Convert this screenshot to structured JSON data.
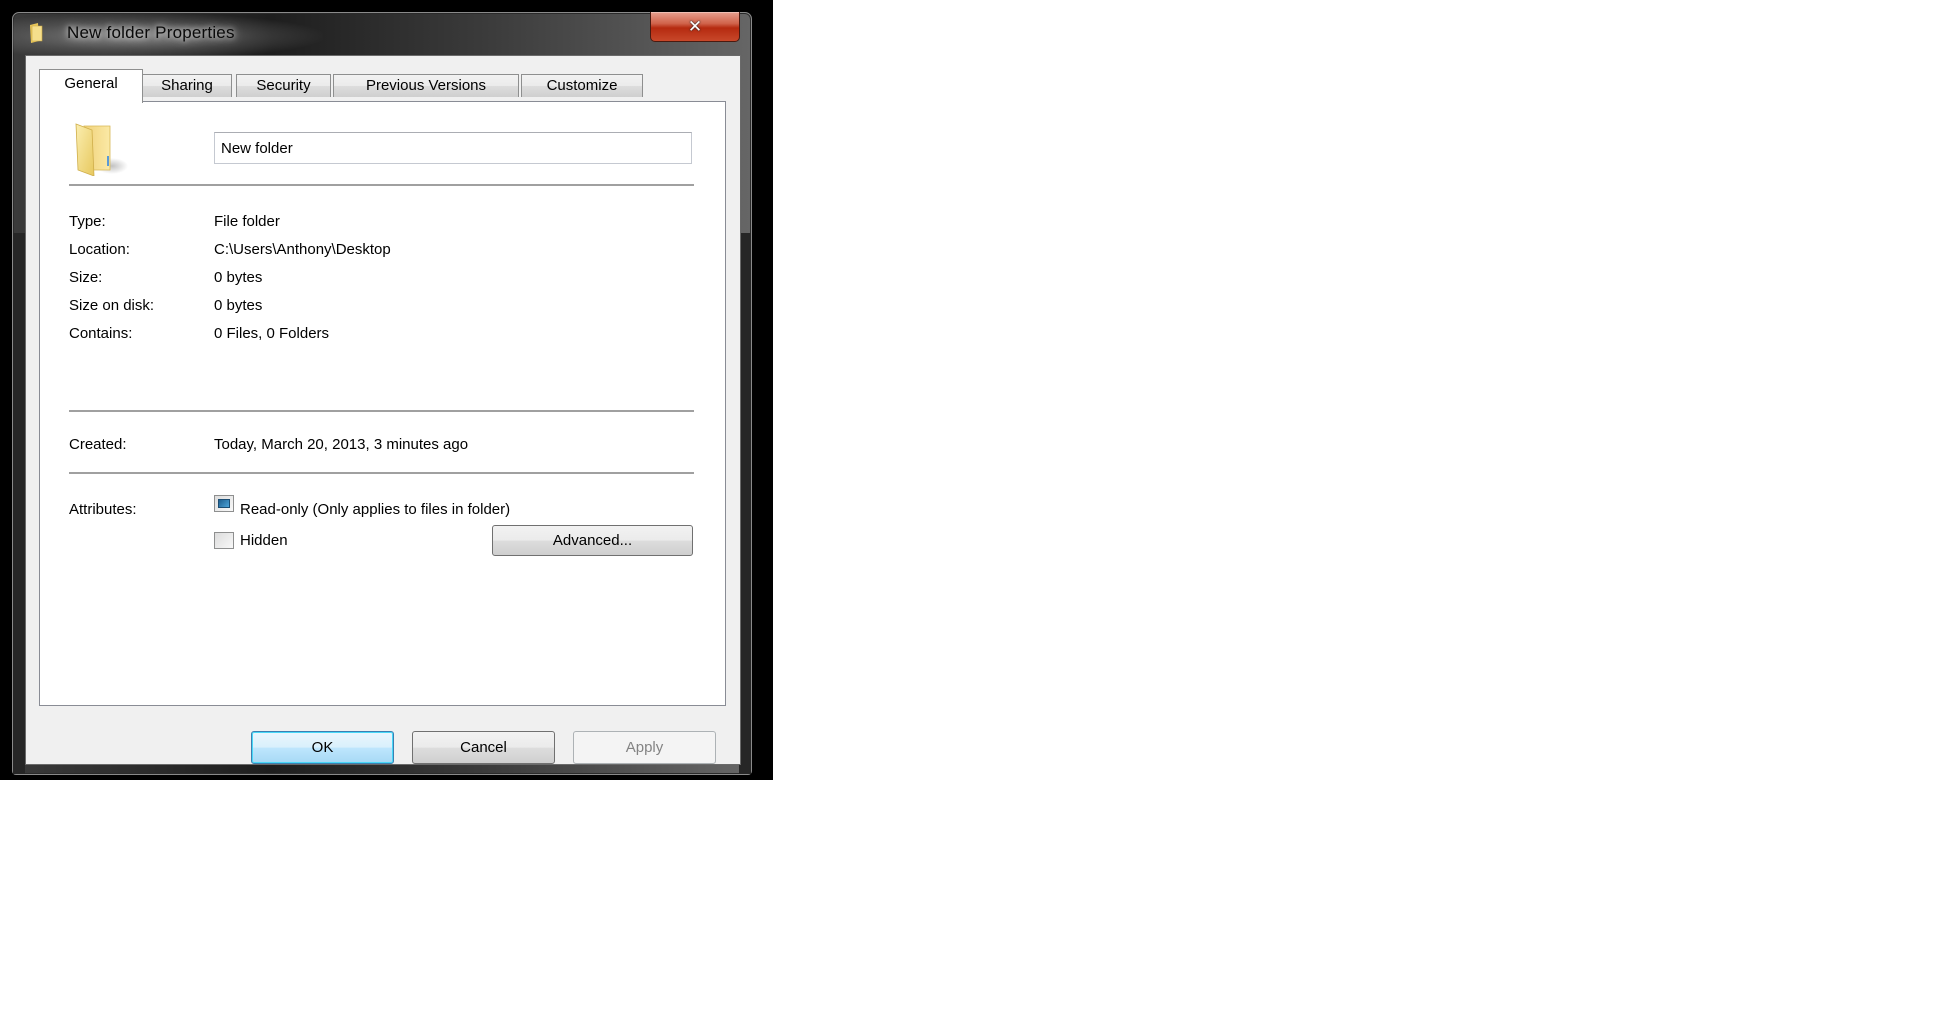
{
  "window": {
    "title": "New folder Properties",
    "title_icon": "folder-icon",
    "close_icon": "close-icon",
    "close_glyph": "✕"
  },
  "tabs": [
    {
      "label": "General",
      "active": true
    },
    {
      "label": "Sharing",
      "active": false
    },
    {
      "label": "Security",
      "active": false
    },
    {
      "label": "Previous Versions",
      "active": false
    },
    {
      "label": "Customize",
      "active": false
    }
  ],
  "general": {
    "icon": "folder-icon",
    "name_value": "New folder",
    "properties": [
      {
        "label": "Type:",
        "value": "File folder"
      },
      {
        "label": "Location:",
        "value": "C:\\Users\\Anthony\\Desktop"
      },
      {
        "label": "Size:",
        "value": "0 bytes"
      },
      {
        "label": "Size on disk:",
        "value": "0 bytes"
      },
      {
        "label": "Contains:",
        "value": "0 Files, 0 Folders"
      }
    ],
    "created": {
      "label": "Created:",
      "value": "Today, March 20, 2013, 3 minutes ago"
    },
    "attributes": {
      "label": "Attributes:",
      "readonly": {
        "label": "Read-only (Only applies to files in folder)",
        "state": "indeterminate"
      },
      "hidden": {
        "label": "Hidden",
        "state": "unchecked"
      },
      "advanced_label": "Advanced..."
    }
  },
  "buttons": {
    "ok": "OK",
    "cancel": "Cancel",
    "apply": "Apply",
    "apply_enabled": false
  },
  "colors": {
    "default_button_border": "#3c7fb1",
    "close_button": "#c8482a",
    "checkbox_indeterminate": "#2f86c0"
  }
}
